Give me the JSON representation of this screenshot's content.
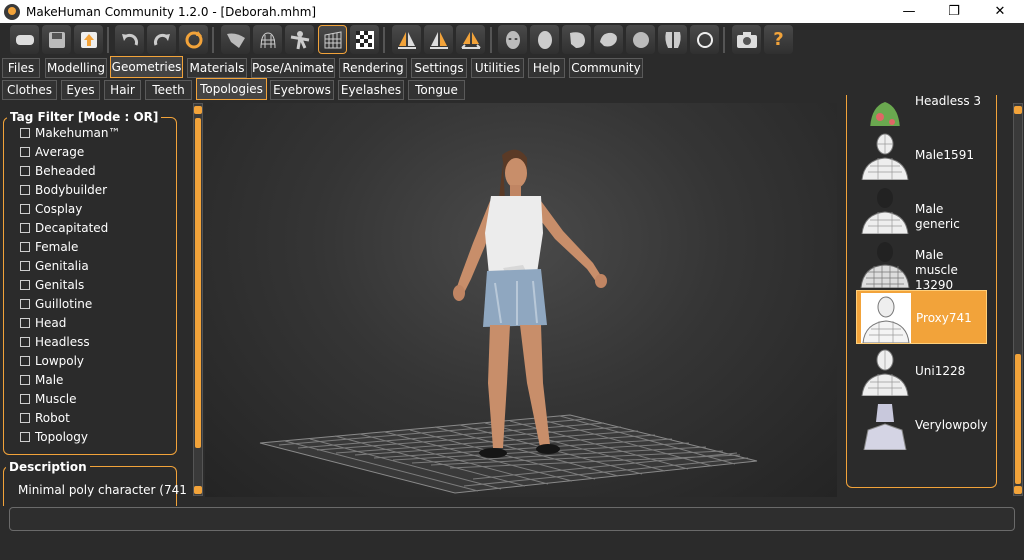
{
  "window": {
    "title": "MakeHuman Community 1.2.0 - [Deborah.mhm]",
    "minimize": "—",
    "maximize": "❐",
    "close": "✕"
  },
  "toolbar": {
    "buttons": [
      "new-icon",
      "save-icon",
      "export-icon",
      "undo-icon",
      "redo-icon",
      "reset-icon",
      "smooth-icon",
      "wireframe-icon",
      "pose-icon",
      "grid-icon",
      "checker-icon",
      "front-view-icon",
      "back-view-icon",
      "left-right-view-icon",
      "face-icon",
      "head-icon",
      "side-icon",
      "ear-icon",
      "sphere-icon",
      "legs-icon",
      "circle-icon",
      "camera-icon",
      "help-icon"
    ]
  },
  "main_tabs": [
    "Files",
    "Modelling",
    "Geometries",
    "Materials",
    "Pose/Animate",
    "Rendering",
    "Settings",
    "Utilities",
    "Help",
    "Community"
  ],
  "main_active": "Geometries",
  "sub_tabs": [
    "Clothes",
    "Eyes",
    "Hair",
    "Teeth",
    "Topologies",
    "Eyebrows",
    "Eyelashes",
    "Tongue"
  ],
  "sub_active": "Topologies",
  "tag_filter": {
    "title": "Tag Filter [Mode : OR]",
    "tags": [
      "Makehuman™",
      "Average",
      "Beheaded",
      "Bodybuilder",
      "Cosplay",
      "Decapitated",
      "Female",
      "Genitalia",
      "Genitals",
      "Guillotine",
      "Head",
      "Headless",
      "Lowpoly",
      "Male",
      "Muscle",
      "Robot",
      "Topology"
    ]
  },
  "description": {
    "title": "Description",
    "text": "Minimal poly character (741"
  },
  "topologies": [
    {
      "name": "Headless 3"
    },
    {
      "name": "Male1591"
    },
    {
      "name": "Male generic"
    },
    {
      "name": "Male muscle 13290"
    },
    {
      "name": "Proxy741",
      "selected": true
    },
    {
      "name": "Uni1228"
    },
    {
      "name": "Verylowpoly"
    }
  ],
  "colors": {
    "accent": "#f2a33a",
    "background": "#2b2b2b"
  }
}
